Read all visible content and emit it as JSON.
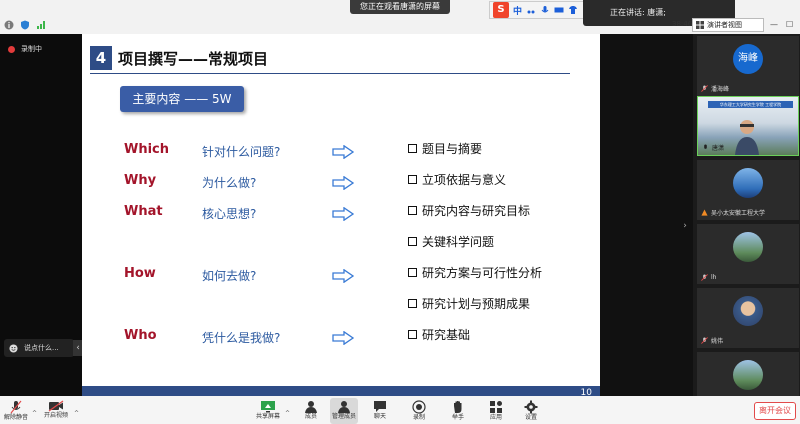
{
  "top": {
    "share_banner": "您正在观看唐潇的屏幕",
    "ime_logo": "S",
    "ime_lang": "中",
    "speaking_label": "正在讲话:",
    "speaker": "唐潇;",
    "timer": "38:46",
    "view_button": "演讲者视图"
  },
  "left": {
    "recording_label": "录制中",
    "chat_placeholder": "说点什么..."
  },
  "slide": {
    "number": "4",
    "title": "项目撰写——常规项目",
    "pill": "主要内容 —— 5W",
    "rows": [
      {
        "key": "Which",
        "question": "针对什么问题?",
        "answer": "题目与摘要"
      },
      {
        "key": "Why",
        "question": "为什么做?",
        "answer": "立项依据与意义"
      },
      {
        "key": "What",
        "question": "核心思想?",
        "answer": "研究内容与研究目标"
      },
      {
        "key": "",
        "question": "",
        "answer": "关键科学问题"
      },
      {
        "key": "How",
        "question": "如何去做?",
        "answer": "研究方案与可行性分析"
      },
      {
        "key": "",
        "question": "",
        "answer": "研究计划与预期成果"
      },
      {
        "key": "Who",
        "question": "凭什么是我做?",
        "answer": "研究基础"
      }
    ],
    "page": "10",
    "colors": {
      "navy": "#2e4c86",
      "key_red": "#a3142a",
      "question_blue": "#2c5aa0",
      "arrow_blue": "#3a7bd5"
    }
  },
  "participants": [
    {
      "name": "潘海峰",
      "avatar_text": "海峰",
      "avatar": "blue-initials"
    },
    {
      "name": "唐潇",
      "avatar": "camera",
      "cam_banner": "华东理工大学研究生学院 工程学院",
      "active": true
    },
    {
      "name": "吴小太安徽工程大学",
      "avatar": "sky-photo",
      "host_icon": true
    },
    {
      "name": "lh",
      "avatar": "landscape-photo"
    },
    {
      "name": "姚伟",
      "avatar": "face-photo"
    },
    {
      "name": "",
      "avatar": "landscape-photo"
    }
  ],
  "toolbar": {
    "mute": "解除静音",
    "video": "开启视频",
    "share": "共享屏幕",
    "members": "成员",
    "manage": "管理成员",
    "chat": "聊天",
    "record": "录制",
    "reaction": "举手",
    "apps": "应用",
    "settings": "设置",
    "leave": "离开会议"
  }
}
